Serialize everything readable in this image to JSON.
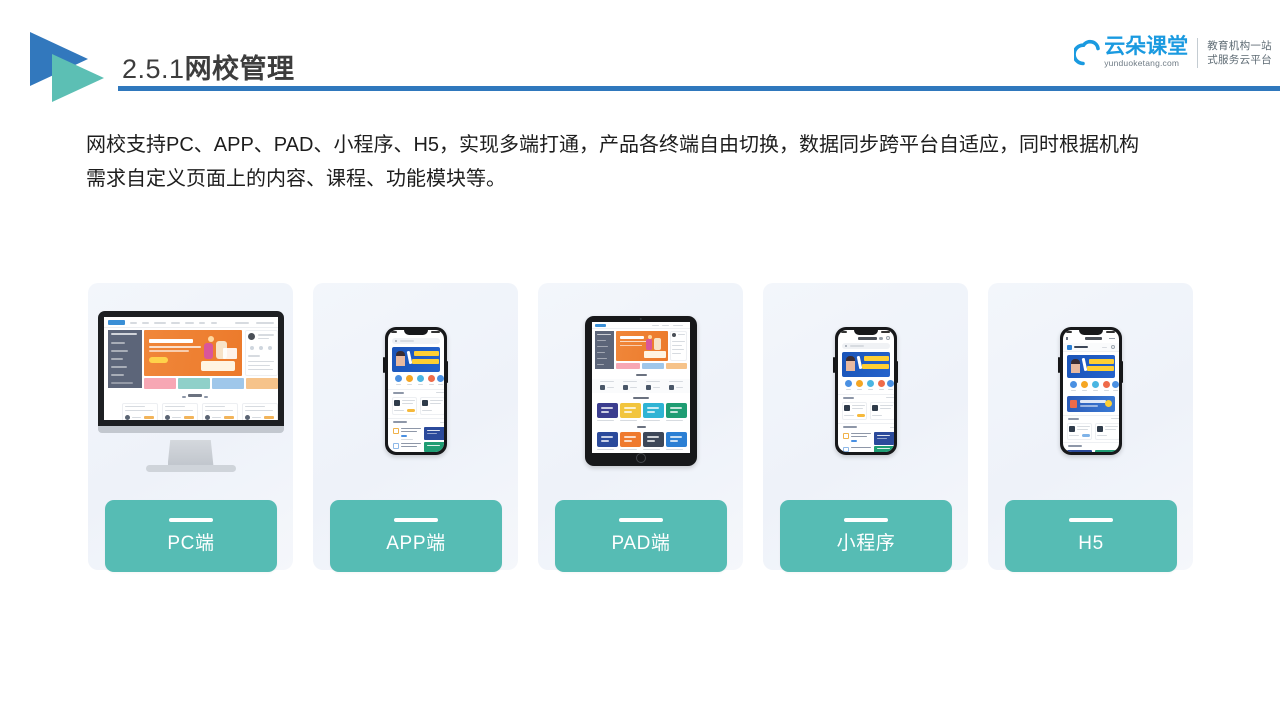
{
  "header": {
    "section_number": "2.5.1",
    "title_cn": "网校管理",
    "accent_blue": "#2f78bd",
    "accent_teal": "#56bcb4"
  },
  "brand": {
    "name": "云朵课堂",
    "url": "yunduoketang.com",
    "tagline_line1": "教育机构一站",
    "tagline_line2": "式服务云平台",
    "logo_icon": "cloud-icon",
    "brand_color": "#1a9ae0"
  },
  "lead": {
    "line1": "网校支持PC、APP、PAD、小程序、H5，实现多端打通，产品各终端自由切换，数据同步跨平台自适应，同时根据机构",
    "line2": "需求自定义页面上的内容、课程、功能模块等。"
  },
  "cards": [
    {
      "label": "PC端",
      "device": "desktop",
      "device_icon": "desktop-monitor-icon"
    },
    {
      "label": "APP端",
      "device": "phone",
      "device_icon": "mobile-phone-icon"
    },
    {
      "label": "PAD端",
      "device": "tablet",
      "device_icon": "tablet-icon"
    },
    {
      "label": "小程序",
      "device": "phone",
      "device_icon": "mobile-phone-icon"
    },
    {
      "label": "H5",
      "device": "phone",
      "device_icon": "mobile-phone-icon"
    }
  ],
  "mock_screens": {
    "desktop_hero_title": "在线学习平台",
    "phone_hero_title": "职场人的",
    "phone_hero_sub": "第一堂沟通课"
  }
}
